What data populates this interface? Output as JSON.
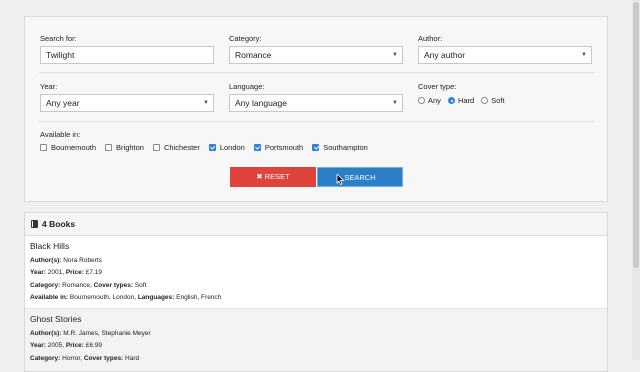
{
  "search": {
    "search_label": "Search for:",
    "search_value": "Twilight",
    "category_label": "Category:",
    "category_value": "Romance",
    "author_label": "Author:",
    "author_value": "Any author",
    "year_label": "Year:",
    "year_value": "Any year",
    "language_label": "Language:",
    "language_value": "Any language",
    "cover_label": "Cover type:",
    "cover_options": [
      "Any",
      "Hard",
      "Soft"
    ],
    "cover_selected": "Hard",
    "available_label": "Available in:",
    "locations": [
      {
        "label": "Bournemouth",
        "checked": false
      },
      {
        "label": "Brighton",
        "checked": false
      },
      {
        "label": "Chichester",
        "checked": false
      },
      {
        "label": "London",
        "checked": true
      },
      {
        "label": "Portsmouth",
        "checked": true
      },
      {
        "label": "Southampton",
        "checked": true
      }
    ],
    "reset_label": "✖ RESET",
    "search_button_label": "SEARCH"
  },
  "results": {
    "header": "4 Books",
    "labels": {
      "authors": "Author(s):",
      "year": "Year:",
      "price": "Price:",
      "category": "Category:",
      "cover": "Cover types:",
      "available": "Available in:",
      "languages": "Languages:"
    },
    "books": [
      {
        "title": "Black Hills",
        "authors": "Nora Roberts",
        "year": "2001",
        "price": "£7.19",
        "category": "Romance",
        "cover": "Soft",
        "available": "Bournemouth, London",
        "languages": "English, French"
      },
      {
        "title": "Ghost Stories",
        "authors": "M.R. James, Stephanie Meyer",
        "year": "2005",
        "price": "£6.99",
        "category": "Horror",
        "cover": "Hard"
      }
    ]
  },
  "colors": {
    "accent_blue": "#2a7fc6",
    "reset_red": "#e0433b",
    "checkbox_blue": "#2f86d6"
  }
}
